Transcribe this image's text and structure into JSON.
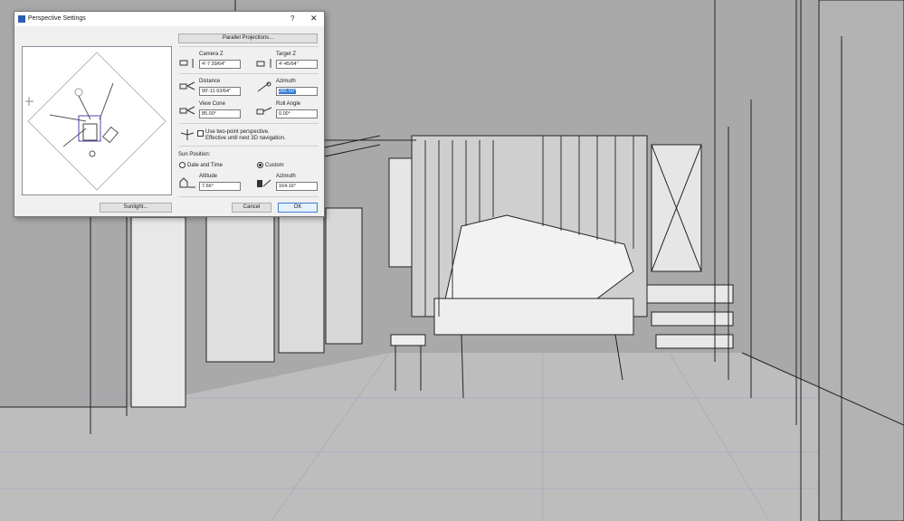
{
  "dialog": {
    "title": "Perspective Settings",
    "help": "?",
    "close": "✕",
    "parallel_projections": "Parallel Projections...",
    "camera_z": {
      "label": "Camera Z",
      "value": "4'-7 39/64\""
    },
    "target_z": {
      "label": "Target Z",
      "value": "4'-45/64\""
    },
    "distance": {
      "label": "Distance",
      "value": "99'-11 63/64\""
    },
    "azimuth": {
      "label": "Azimuth",
      "value": "285.50°"
    },
    "view_cone": {
      "label": "View Cone",
      "value": "85.00°"
    },
    "roll_angle": {
      "label": "Roll Angle",
      "value": "0.00°"
    },
    "two_point": {
      "line1": "Use two-point perspective.",
      "line2": "Effective until next 3D navigation.",
      "checked": false
    },
    "sun_position": {
      "label": "Sun Position:",
      "date_time": "Date and Time",
      "custom": "Custom",
      "selected": "custom",
      "altitude": {
        "label": "Altitude",
        "value": "7.66°"
      },
      "azimuth": {
        "label": "Azimuth",
        "value": "164.16°"
      }
    },
    "sunlight": "Sunlight...",
    "cancel": "Cancel",
    "ok": "OK"
  }
}
